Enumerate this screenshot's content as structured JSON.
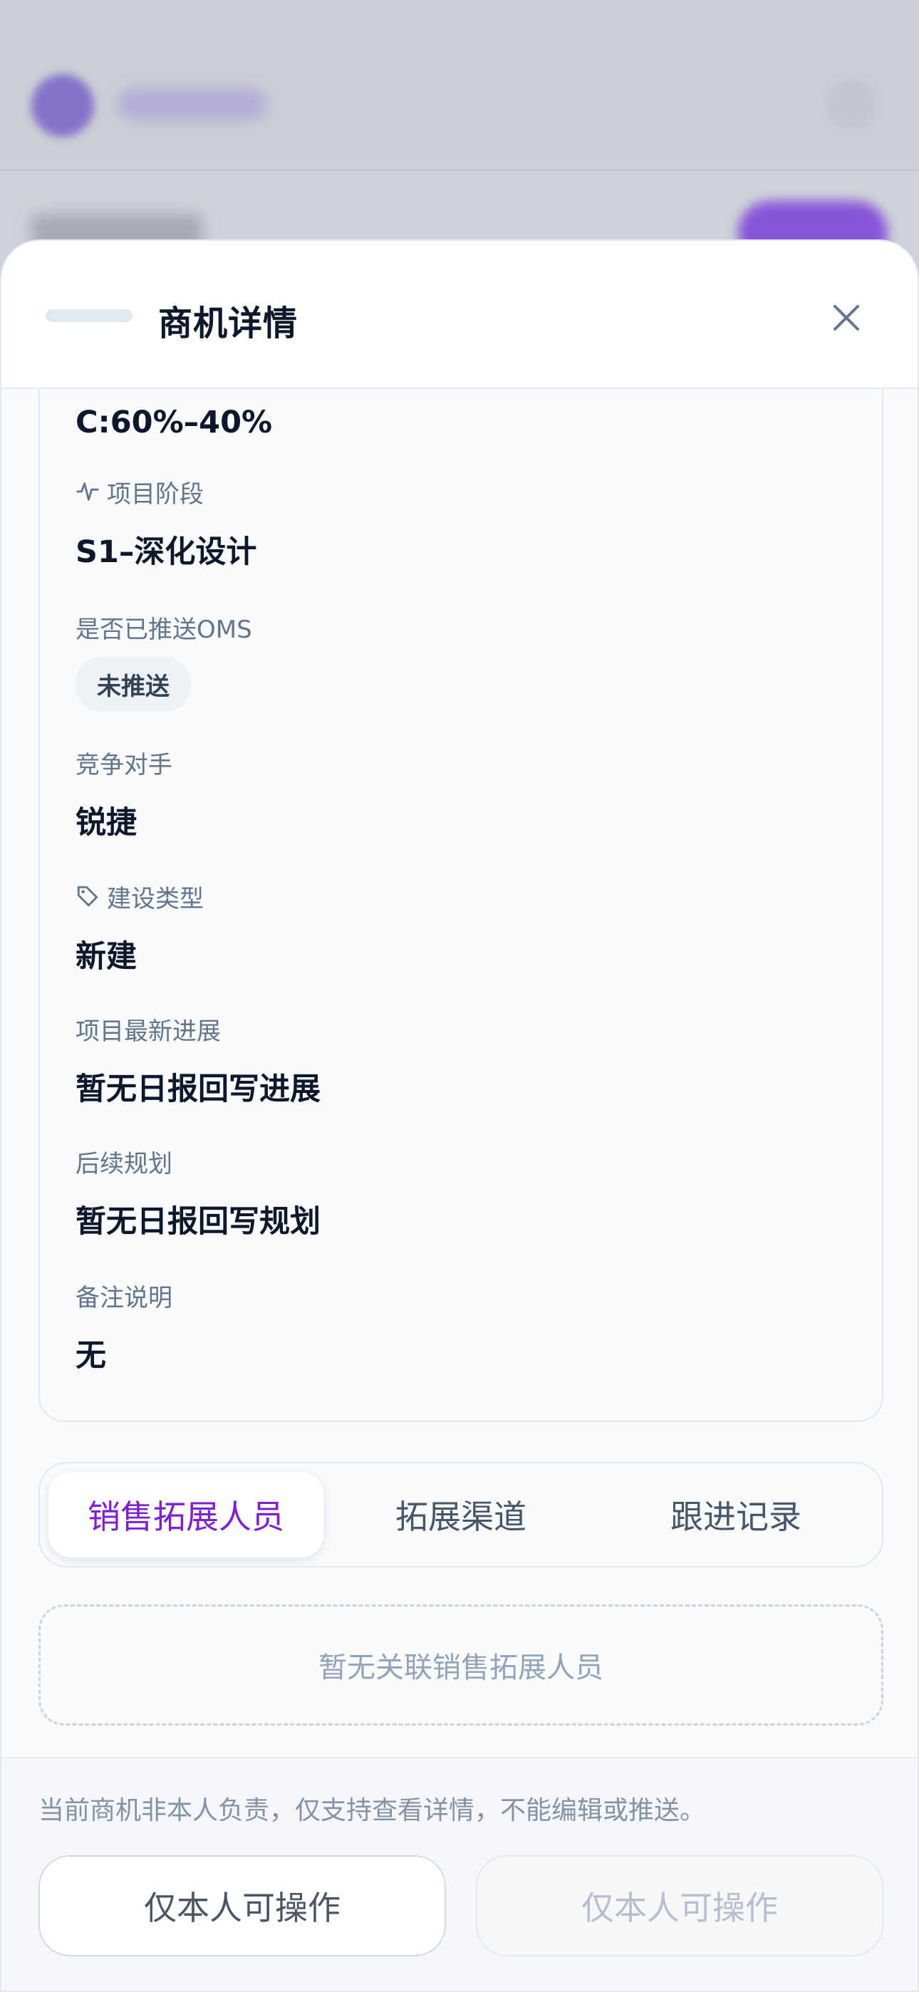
{
  "sheet": {
    "title": "商机详情"
  },
  "details": {
    "ratio_value": "C:60%–40%",
    "stage_label": "项目阶段",
    "stage_value": "S1–深化设计",
    "oms_label": "是否已推送OMS",
    "oms_status": "未推送",
    "competitor_label": "竞争对手",
    "competitor_value": "锐捷",
    "build_type_label": "建设类型",
    "build_type_value": "新建",
    "progress_label": "项目最新进展",
    "progress_value": "暂无日报回写进展",
    "plan_label": "后续规划",
    "plan_value": "暂无日报回写规划",
    "remark_label": "备注说明",
    "remark_value": "无"
  },
  "tabs": [
    {
      "label": "销售拓展人员",
      "active": true
    },
    {
      "label": "拓展渠道",
      "active": false
    },
    {
      "label": "跟进记录",
      "active": false
    }
  ],
  "empty_text": "暂无关联销售拓展人员",
  "footer": {
    "note": "当前商机非本人负责，仅支持查看详情，不能编辑或推送。",
    "button_1": "仅本人可操作",
    "button_2": "仅本人可操作"
  },
  "colors": {
    "accent": "#7c1fd6",
    "text": "#0f172a",
    "muted": "#64748b"
  },
  "icons": [
    "close-icon",
    "activity-icon",
    "tag-icon"
  ]
}
